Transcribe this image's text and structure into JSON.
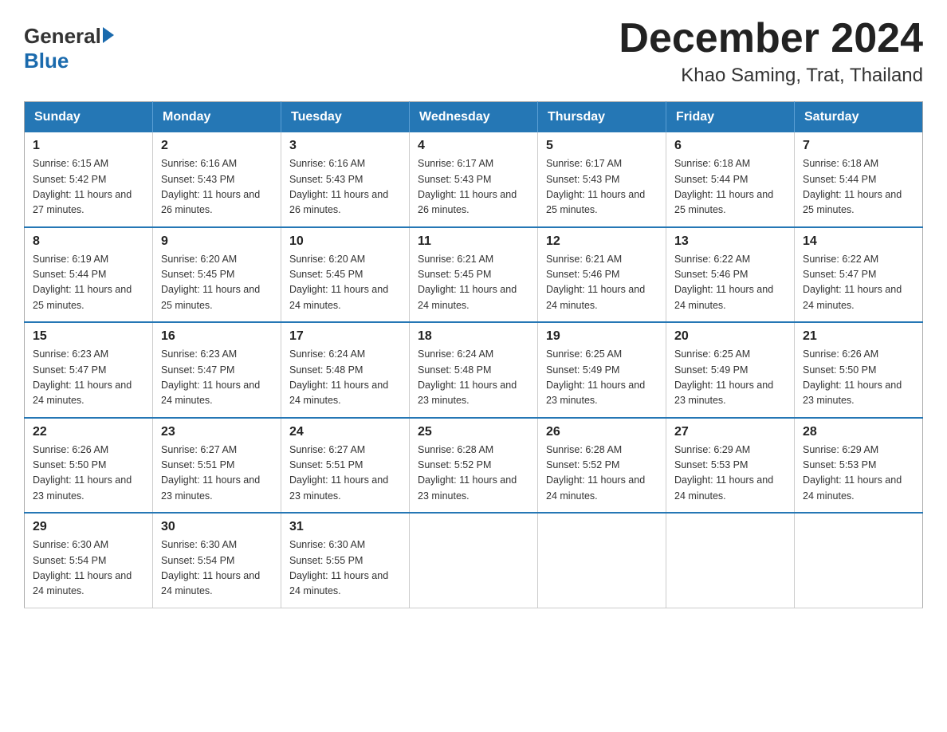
{
  "header": {
    "logo_general": "General",
    "logo_blue": "Blue",
    "title": "December 2024",
    "subtitle": "Khao Saming, Trat, Thailand"
  },
  "weekdays": [
    "Sunday",
    "Monday",
    "Tuesday",
    "Wednesday",
    "Thursday",
    "Friday",
    "Saturday"
  ],
  "weeks": [
    [
      {
        "day": "1",
        "sunrise": "6:15 AM",
        "sunset": "5:42 PM",
        "daylight": "11 hours and 27 minutes."
      },
      {
        "day": "2",
        "sunrise": "6:16 AM",
        "sunset": "5:43 PM",
        "daylight": "11 hours and 26 minutes."
      },
      {
        "day": "3",
        "sunrise": "6:16 AM",
        "sunset": "5:43 PM",
        "daylight": "11 hours and 26 minutes."
      },
      {
        "day": "4",
        "sunrise": "6:17 AM",
        "sunset": "5:43 PM",
        "daylight": "11 hours and 26 minutes."
      },
      {
        "day": "5",
        "sunrise": "6:17 AM",
        "sunset": "5:43 PM",
        "daylight": "11 hours and 25 minutes."
      },
      {
        "day": "6",
        "sunrise": "6:18 AM",
        "sunset": "5:44 PM",
        "daylight": "11 hours and 25 minutes."
      },
      {
        "day": "7",
        "sunrise": "6:18 AM",
        "sunset": "5:44 PM",
        "daylight": "11 hours and 25 minutes."
      }
    ],
    [
      {
        "day": "8",
        "sunrise": "6:19 AM",
        "sunset": "5:44 PM",
        "daylight": "11 hours and 25 minutes."
      },
      {
        "day": "9",
        "sunrise": "6:20 AM",
        "sunset": "5:45 PM",
        "daylight": "11 hours and 25 minutes."
      },
      {
        "day": "10",
        "sunrise": "6:20 AM",
        "sunset": "5:45 PM",
        "daylight": "11 hours and 24 minutes."
      },
      {
        "day": "11",
        "sunrise": "6:21 AM",
        "sunset": "5:45 PM",
        "daylight": "11 hours and 24 minutes."
      },
      {
        "day": "12",
        "sunrise": "6:21 AM",
        "sunset": "5:46 PM",
        "daylight": "11 hours and 24 minutes."
      },
      {
        "day": "13",
        "sunrise": "6:22 AM",
        "sunset": "5:46 PM",
        "daylight": "11 hours and 24 minutes."
      },
      {
        "day": "14",
        "sunrise": "6:22 AM",
        "sunset": "5:47 PM",
        "daylight": "11 hours and 24 minutes."
      }
    ],
    [
      {
        "day": "15",
        "sunrise": "6:23 AM",
        "sunset": "5:47 PM",
        "daylight": "11 hours and 24 minutes."
      },
      {
        "day": "16",
        "sunrise": "6:23 AM",
        "sunset": "5:47 PM",
        "daylight": "11 hours and 24 minutes."
      },
      {
        "day": "17",
        "sunrise": "6:24 AM",
        "sunset": "5:48 PM",
        "daylight": "11 hours and 24 minutes."
      },
      {
        "day": "18",
        "sunrise": "6:24 AM",
        "sunset": "5:48 PM",
        "daylight": "11 hours and 23 minutes."
      },
      {
        "day": "19",
        "sunrise": "6:25 AM",
        "sunset": "5:49 PM",
        "daylight": "11 hours and 23 minutes."
      },
      {
        "day": "20",
        "sunrise": "6:25 AM",
        "sunset": "5:49 PM",
        "daylight": "11 hours and 23 minutes."
      },
      {
        "day": "21",
        "sunrise": "6:26 AM",
        "sunset": "5:50 PM",
        "daylight": "11 hours and 23 minutes."
      }
    ],
    [
      {
        "day": "22",
        "sunrise": "6:26 AM",
        "sunset": "5:50 PM",
        "daylight": "11 hours and 23 minutes."
      },
      {
        "day": "23",
        "sunrise": "6:27 AM",
        "sunset": "5:51 PM",
        "daylight": "11 hours and 23 minutes."
      },
      {
        "day": "24",
        "sunrise": "6:27 AM",
        "sunset": "5:51 PM",
        "daylight": "11 hours and 23 minutes."
      },
      {
        "day": "25",
        "sunrise": "6:28 AM",
        "sunset": "5:52 PM",
        "daylight": "11 hours and 23 minutes."
      },
      {
        "day": "26",
        "sunrise": "6:28 AM",
        "sunset": "5:52 PM",
        "daylight": "11 hours and 24 minutes."
      },
      {
        "day": "27",
        "sunrise": "6:29 AM",
        "sunset": "5:53 PM",
        "daylight": "11 hours and 24 minutes."
      },
      {
        "day": "28",
        "sunrise": "6:29 AM",
        "sunset": "5:53 PM",
        "daylight": "11 hours and 24 minutes."
      }
    ],
    [
      {
        "day": "29",
        "sunrise": "6:30 AM",
        "sunset": "5:54 PM",
        "daylight": "11 hours and 24 minutes."
      },
      {
        "day": "30",
        "sunrise": "6:30 AM",
        "sunset": "5:54 PM",
        "daylight": "11 hours and 24 minutes."
      },
      {
        "day": "31",
        "sunrise": "6:30 AM",
        "sunset": "5:55 PM",
        "daylight": "11 hours and 24 minutes."
      },
      null,
      null,
      null,
      null
    ]
  ],
  "labels": {
    "sunrise_prefix": "Sunrise: ",
    "sunset_prefix": "Sunset: ",
    "daylight_prefix": "Daylight: "
  }
}
